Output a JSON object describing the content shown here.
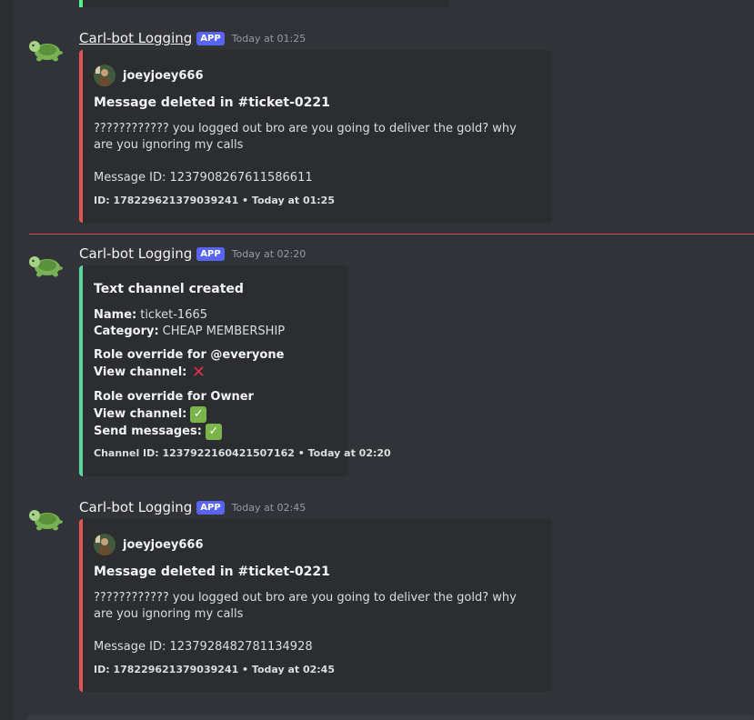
{
  "messages": [
    {
      "author": "Carl-bot Logging",
      "app_tag": "APP",
      "timestamp": "Today at 01:25",
      "embed": {
        "author_name": "joeyjoey666",
        "title": "Message deleted in #ticket-0221",
        "description": "???????????? you logged out bro are you going to deliver the gold? why are you ignoring my calls",
        "message_id": "Message ID: 1237908267611586611",
        "footer": "ID: 178229621379039241 • Today at 01:25",
        "border_color": "#e45454"
      }
    },
    {
      "author": "Carl-bot Logging",
      "app_tag": "APP",
      "timestamp": "Today at 02:20",
      "embed": {
        "title": "Text channel created",
        "name_label": "Name:",
        "name_value": "ticket-1665",
        "category_label": "Category:",
        "category_value": "CHEAP MEMBERSHIP",
        "override1_title": "Role override for @everyone",
        "override1_view_label": "View channel:",
        "override1_view_emoji": "cross",
        "override2_title": "Role override for Owner",
        "override2_view_label": "View channel:",
        "override2_view_emoji": "check",
        "override2_send_label": "Send messages:",
        "override2_send_emoji": "check",
        "footer": "Channel ID: 1237922160421507162 • Today at 02:20",
        "border_color": "#57d6a0"
      }
    },
    {
      "author": "Carl-bot Logging",
      "app_tag": "APP",
      "timestamp": "Today at 02:45",
      "embed": {
        "author_name": "joeyjoey666",
        "title": "Message deleted in #ticket-0221",
        "description": "???????????? you logged out bro are you going to deliver the gold? why are you ignoring my calls",
        "message_id": "Message ID: 1237928482781134928",
        "footer": "ID: 178229621379039241 • Today at 02:45",
        "border_color": "#e45454"
      }
    }
  ],
  "icons": {
    "bot_avatar": "turtle-icon",
    "user_avatar": "user-avatar",
    "check_emoji": "✓",
    "cross_emoji": "✕"
  }
}
